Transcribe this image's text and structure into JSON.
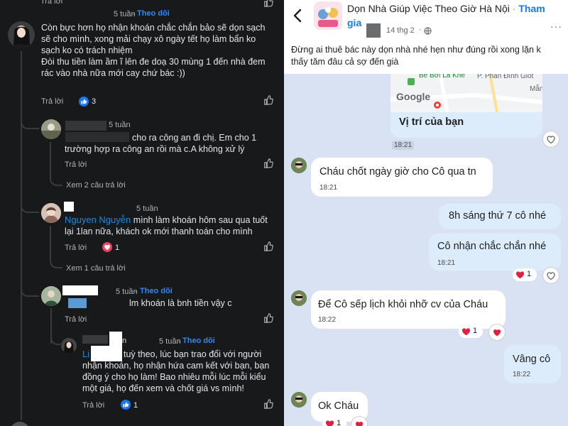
{
  "left": {
    "top_reply": "Trả lời",
    "comment1": {
      "time": "5 tuần",
      "follow": "Theo dõi",
      "text_lines": [
        "Còn bực hơn họ nhận khoán  chắc chắn bảo sẽ dọn sạch",
        "sẽ cho mình, xong mải chạy xô ngày tết họ làm bẩn ko",
        "sạch ko có trách nhiệm",
        "Đòi thu tiền làm ầm ĩ lên đe doạ 30 mùng 1 đến nhà đem",
        "rác vào nhà nữa mới cay chứ bác :))"
      ],
      "reply": "Trả lời",
      "like_count": "3"
    },
    "comment2": {
      "time": "5 tuần",
      "text_lines": [
        "cho ra công an đi chị. Em cho 1",
        "trường hợp ra công an rồi mà c.A không xử lý"
      ],
      "reply": "Trả lời",
      "see_replies": "Xem 2 câu trả lời"
    },
    "comment3": {
      "time": "5 tuần",
      "name": "Nguyen Nguyễn",
      "text_first": "mình làm khoán hôm sau qua tuốt",
      "text_lines": [
        "lại 1lan nữa, khách ok mới thanh toán cho mình"
      ],
      "reply": "Trả lời",
      "love_count": "1",
      "see_replies": "Xem 1 câu trả lời"
    },
    "comment4": {
      "time": "5 tuần",
      "follow": "Theo dõi",
      "text_first": "lm khoán là bnh tiền vậy c",
      "reply": "Trả lời"
    },
    "comment5": {
      "time": "5 tuần",
      "follow": "Theo dõi",
      "name_prefix": "Li",
      "text_first": "tuỳ theo, lúc bạn trao đổi với người",
      "text_lines": [
        "nhận khoán, họ nhận hứa cam kết với bạn, bạn",
        "đồng ý cho họ làm! Bao nhiêu mỗi lúc mỗi kiểu",
        "một giá, họ đến xem và chốt giá vs mình!"
      ],
      "reply": "Trả lời",
      "like_count": "1"
    }
  },
  "right": {
    "group_name": "Dọn Nhà Giúp Việc Theo Giờ Hà Nội",
    "join": "Tham gia",
    "post_date": "14 thg 2",
    "post_text_lines": [
      "Đừng ai thuê bác này dọn nhà nhé hẹn như đúng rồi xong lặn k",
      "thấy tăm đâu cả sợ đến già"
    ],
    "map_labels": {
      "place1": "Bể Bơi La Khê",
      "place2": "P. Phan Đình Giót",
      "place3": "Mẫn",
      "brand": "Google"
    },
    "location_label": "Vị trí của bạn",
    "messages": [
      {
        "text": "",
        "time": "18:21"
      },
      {
        "text": "Cháu chốt ngày giờ cho Cô qua tn",
        "time": "18:21"
      },
      {
        "text": "8h sáng thứ 7 cô nhé",
        "time": ""
      },
      {
        "text": "Cô nhận chắc chắn nhé",
        "time": "18:21",
        "reaction_count": "1"
      },
      {
        "text": "Để Cô sếp lịch khỏi nhỡ cv của Cháu",
        "time": "18:22",
        "reaction_count": "1"
      },
      {
        "text": "Vâng cô",
        "time": "18:22"
      },
      {
        "text": "Ok Cháu",
        "time": "",
        "reaction_count": "1"
      }
    ]
  }
}
